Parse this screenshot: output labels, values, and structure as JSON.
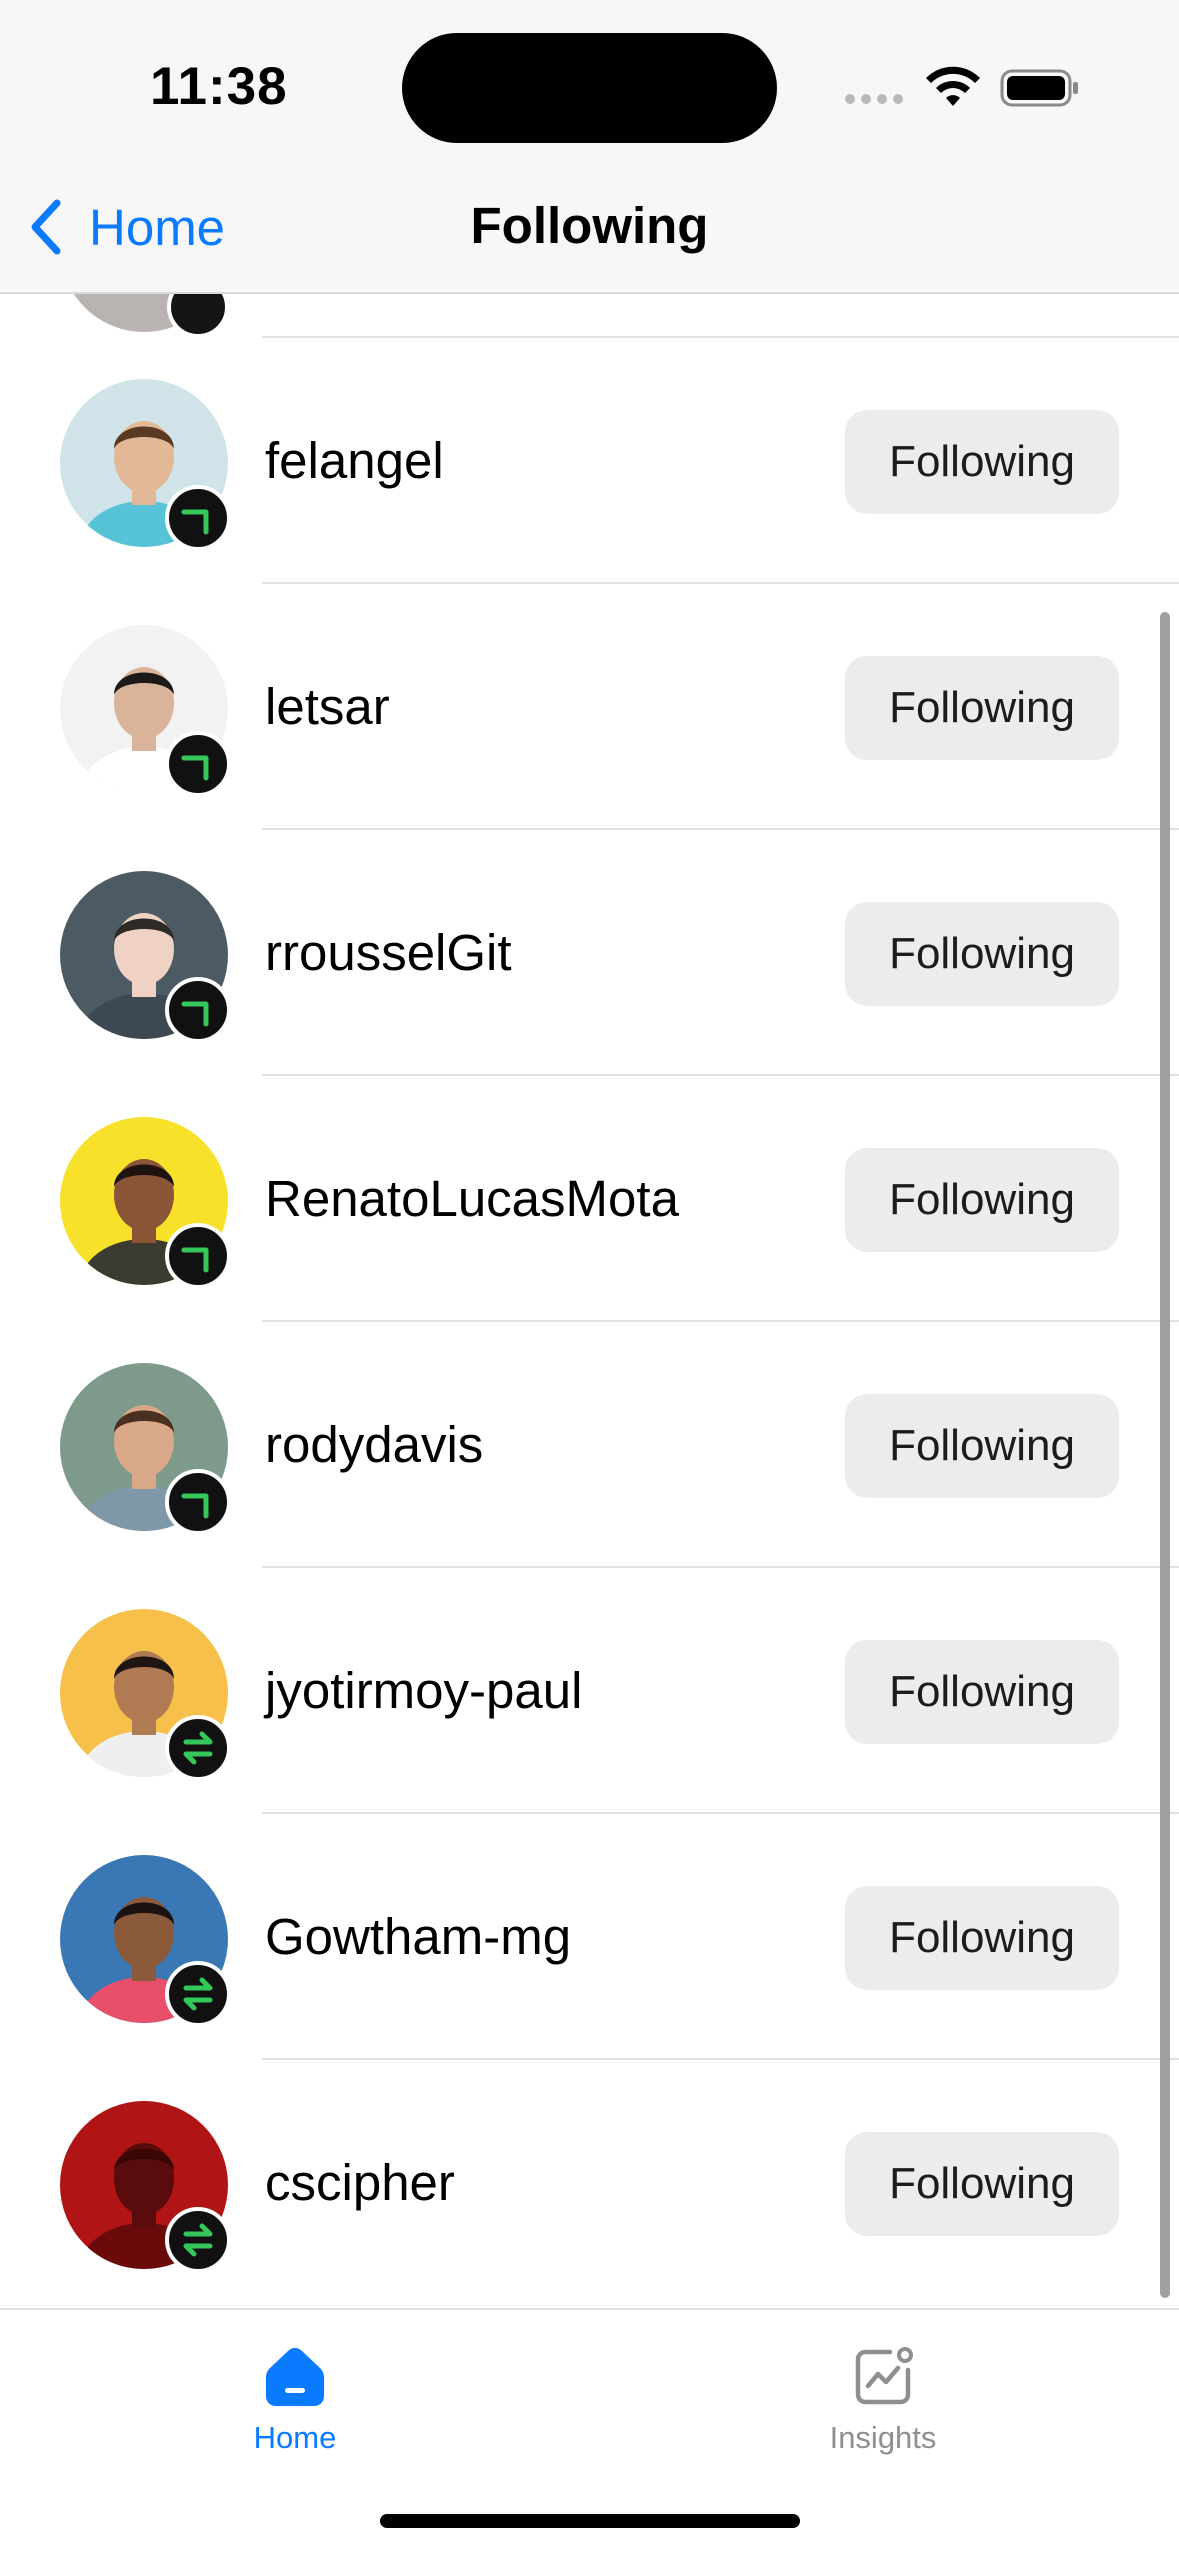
{
  "status_bar": {
    "time": "11:38"
  },
  "nav": {
    "back_label": "Home",
    "title": "Following"
  },
  "users": [
    {
      "username": "felangel",
      "button": "Following",
      "badge": "one-way-arrow-icon",
      "avatar_bg": "#cfe3e8",
      "skin": "#e2b896",
      "hair": "#5a3a22",
      "shirt": "#56c4d6"
    },
    {
      "username": "letsar",
      "button": "Following",
      "badge": "one-way-arrow-icon",
      "avatar_bg": "#f2f2f2",
      "skin": "#d9b49a",
      "hair": "#1c1a18",
      "shirt": "#ffffff"
    },
    {
      "username": "rrousselGit",
      "button": "Following",
      "badge": "one-way-arrow-icon",
      "avatar_bg": "#4b5a63",
      "skin": "#efd2c4",
      "hair": "#2e2a28",
      "shirt": "#3d4852"
    },
    {
      "username": "RenatoLucasMota",
      "button": "Following",
      "badge": "one-way-arrow-icon",
      "avatar_bg": "#f7e12b",
      "skin": "#8a5536",
      "hair": "#1d1410",
      "shirt": "#3b3b32"
    },
    {
      "username": "rodydavis",
      "button": "Following",
      "badge": "one-way-arrow-icon",
      "avatar_bg": "#7e9a8a",
      "skin": "#d8a888",
      "hair": "#4a3020",
      "shirt": "#7f98a8"
    },
    {
      "username": "jyotirmoy-paul",
      "button": "Following",
      "badge": "mutual-arrows-icon",
      "avatar_bg": "#f6c04a",
      "skin": "#b07a52",
      "hair": "#1e1612",
      "shirt": "#efefef"
    },
    {
      "username": "Gowtham-mg",
      "button": "Following",
      "badge": "mutual-arrows-icon",
      "avatar_bg": "#3a78b5",
      "skin": "#8a5a3a",
      "hair": "#1a1210",
      "shirt": "#e8506a"
    },
    {
      "username": "cscipher",
      "button": "Following",
      "badge": "mutual-arrows-icon",
      "avatar_bg": "#b01414",
      "skin": "#5a0c0c",
      "hair": "#3a0606",
      "shirt": "#6a0a0a"
    }
  ],
  "tabs": [
    {
      "label": "Home",
      "icon": "home-icon",
      "active": true
    },
    {
      "label": "Insights",
      "icon": "insights-chart-icon",
      "active": false
    }
  ],
  "colors": {
    "accent": "#0a7aff",
    "badge_green": "#34c759",
    "inactive": "#8e8e93"
  }
}
